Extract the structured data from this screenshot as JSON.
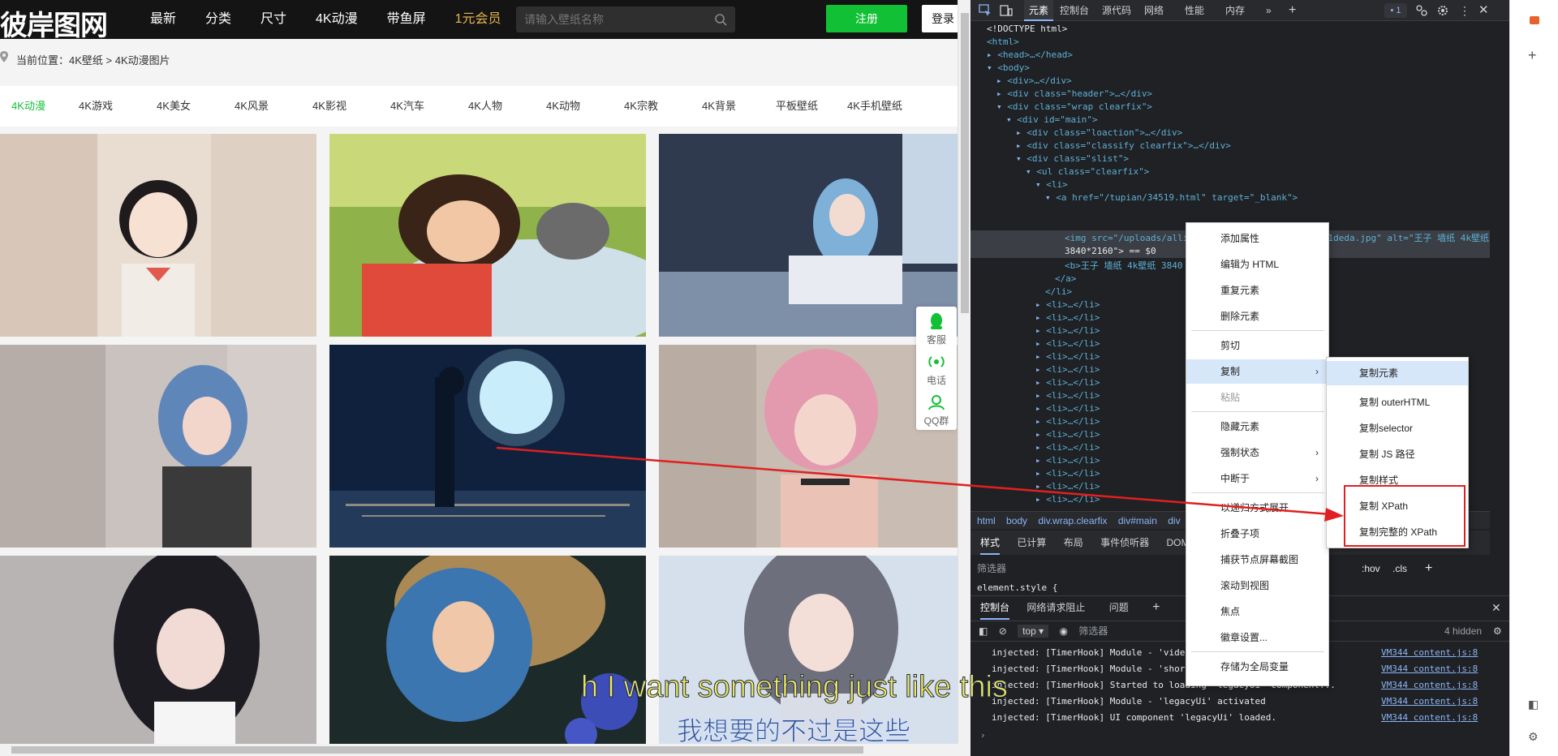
{
  "site": {
    "logo": "彼岸图网",
    "nav": [
      "最新",
      "分类",
      "尺寸",
      "4K动漫",
      "带鱼屏",
      "1元会员"
    ],
    "search_placeholder": "请输入壁纸名称",
    "register_label": "注册",
    "login_label": "登录",
    "crumb": "当前位置：4K壁纸 > 4K动漫图片",
    "tabs": [
      "4K动漫",
      "4K游戏",
      "4K美女",
      "4K风景",
      "4K影视",
      "4K汽车",
      "4K人物",
      "4K动物",
      "4K宗教",
      "4K背景",
      "平板壁纸",
      "4K手机壁纸"
    ],
    "float": [
      "客服",
      "电话",
      "QQ群"
    ],
    "accent_green": "#12c035",
    "vip_gold": "#e8b64a"
  },
  "devtools": {
    "tabs": [
      "元素",
      "控制台",
      "源代码",
      "网络",
      "性能",
      "内存"
    ],
    "issues_count": "1",
    "dom": [
      "<!DOCTYPE html>",
      "<html>",
      "<head>…</head>",
      "<body>",
      "<div>…</div>",
      "<div class=\"header\">…</div>",
      "<div class=\"wrap clearfix\">",
      "<div id=\"main\">",
      "<div class=\"loaction\">…</div>",
      "<div class=\"classify clearfix\">…</div>",
      "<div class=\"slist\">",
      "<ul class=\"clearfix\">",
      "<li>",
      "<a href=\"/tupian/34519.html\" target=\"_blank\">",
      "<img src=\"/uploads/allimg/240618/202141-1718713301deda.jpg\" alt=\"王子 墙纸 4k壁纸",
      "3840*2160\"> == $0",
      "<b>王子 墙纸 4k壁纸 3840",
      "</a>",
      "</li>",
      "<li>…</li>"
    ],
    "breadcrumb": [
      "html",
      "body",
      "div.wrap.clearfix",
      "div#main",
      "div"
    ],
    "styles_tabs": [
      "样式",
      "已计算",
      "布局",
      "事件侦听器",
      "DOM"
    ],
    "filter_placeholder": "筛选器",
    "hov": ":hov",
    "cls": ".cls",
    "element_style": "element.style {",
    "console_tabs": [
      "控制台",
      "网络请求阻止",
      "问题"
    ],
    "console_context": "top",
    "console_filter": "筛选器",
    "hidden_count": "4 hidden",
    "logs": [
      {
        "text": "injected: [TimerHook] Module - 'vide",
        "src": "VM344 content.js:8"
      },
      {
        "text": "injected: [TimerHook] Module - 'shor",
        "src": "VM344 content.js:8"
      },
      {
        "text": "injected: [TimerHook] Started to loading 'legacyUi' component...",
        "src": "VM344 content.js:8"
      },
      {
        "text": "injected: [TimerHook] Module - 'legacyUi' activated",
        "src": "VM344 content.js:8"
      },
      {
        "text": "injected: [TimerHook] UI component 'legacyUi' loaded.",
        "src": "VM344 content.js:8"
      }
    ]
  },
  "context_menu": {
    "items": [
      "添加属性",
      "编辑为 HTML",
      "重复元素",
      "删除元素",
      "剪切",
      "复制",
      "粘贴",
      "隐藏元素",
      "强制状态",
      "中断于",
      "以递归方式展开",
      "折叠子项",
      "捕获节点屏幕截图",
      "滚动到视图",
      "焦点",
      "徽章设置...",
      "存储为全局变量"
    ]
  },
  "submenu": {
    "items": [
      "复制元素",
      "复制 outerHTML",
      "复制selector",
      "复制 JS 路径",
      "复制样式",
      "复制 XPath",
      "复制完整的 XPath"
    ]
  },
  "subtitles": {
    "en": "h I want something just like this",
    "zh": "我想要的不过是这些"
  }
}
